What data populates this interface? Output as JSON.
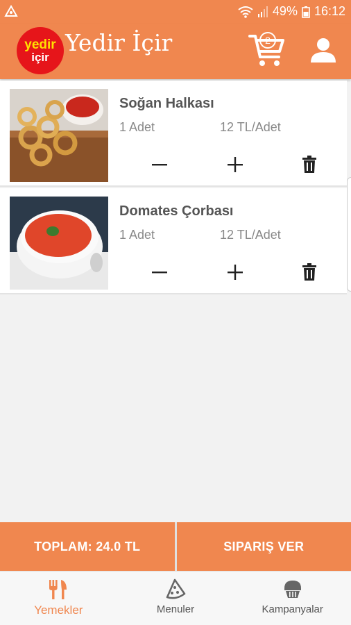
{
  "status_bar": {
    "battery": "49%",
    "time": "16:12"
  },
  "app_bar": {
    "logo_line1": "yedir",
    "logo_line2": "içir",
    "title": "Yedir İçir",
    "cart_count": "2"
  },
  "cart_items": [
    {
      "name": "Soğan Halkası",
      "quantity": "1 Adet",
      "price": "12 TL/Adet"
    },
    {
      "name": "Domates Çorbası",
      "quantity": "1 Adet",
      "price": "12 TL/Adet"
    }
  ],
  "actions": {
    "total": "TOPLAM: 24.0 TL",
    "order": "SIPARIŞ VER"
  },
  "bottom_nav": {
    "items": [
      {
        "label": "Yemekler",
        "icon": "fork-knife-icon",
        "active": true
      },
      {
        "label": "Menuler",
        "icon": "pizza-slice-icon",
        "active": false
      },
      {
        "label": "Kampanyalar",
        "icon": "cupcake-icon",
        "active": false
      }
    ]
  },
  "colors": {
    "primary": "#f0874f",
    "logo_red": "#e6151a",
    "logo_yellow": "#ffe000"
  }
}
